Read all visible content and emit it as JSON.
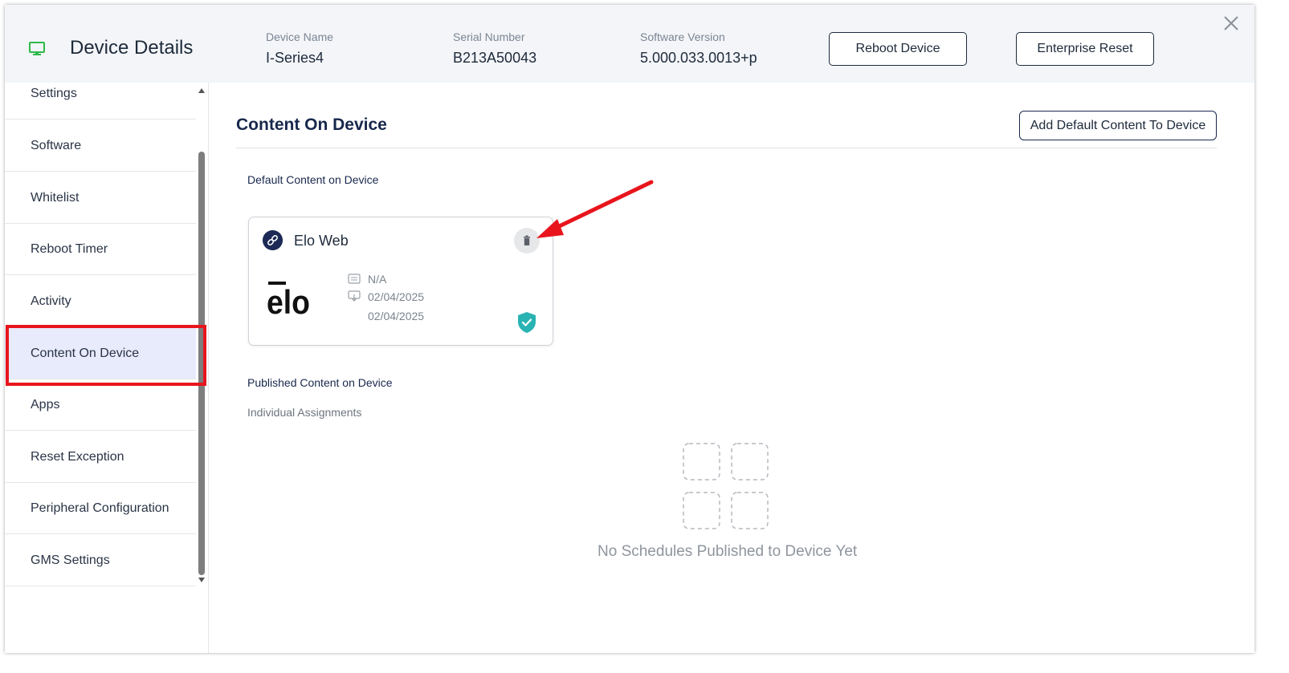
{
  "header": {
    "title": "Device Details",
    "device_name_label": "Device Name",
    "device_name_value": "I-Series4",
    "serial_label": "Serial Number",
    "serial_value": "B213A50043",
    "software_label": "Software Version",
    "software_value": "5.000.033.0013+p",
    "reboot_label": "Reboot Device",
    "reset_label": "Enterprise Reset",
    "monitor_icon_color": "#2fb84a"
  },
  "sidebar": {
    "items": [
      {
        "label": "Settings"
      },
      {
        "label": "Software"
      },
      {
        "label": "Whitelist"
      },
      {
        "label": "Reboot Timer"
      },
      {
        "label": "Activity"
      },
      {
        "label": "Content On Device"
      },
      {
        "label": "Apps"
      },
      {
        "label": "Reset Exception"
      },
      {
        "label": "Peripheral Configuration"
      },
      {
        "label": "GMS Settings"
      }
    ],
    "active": "Content On Device"
  },
  "main": {
    "title": "Content On Device",
    "add_button": "Add Default Content To Device",
    "default_section": "Default Content on Device",
    "card": {
      "title": "Elo Web",
      "logo_text": "ēlo",
      "folder_value": "N/A",
      "date1": "02/04/2025",
      "date2": "02/04/2025",
      "shield_color": "#2ab3b3"
    },
    "published_section": "Published Content on Device",
    "individual": "Individual Assignments",
    "empty_text": "No Schedules Published to Device Yet"
  }
}
